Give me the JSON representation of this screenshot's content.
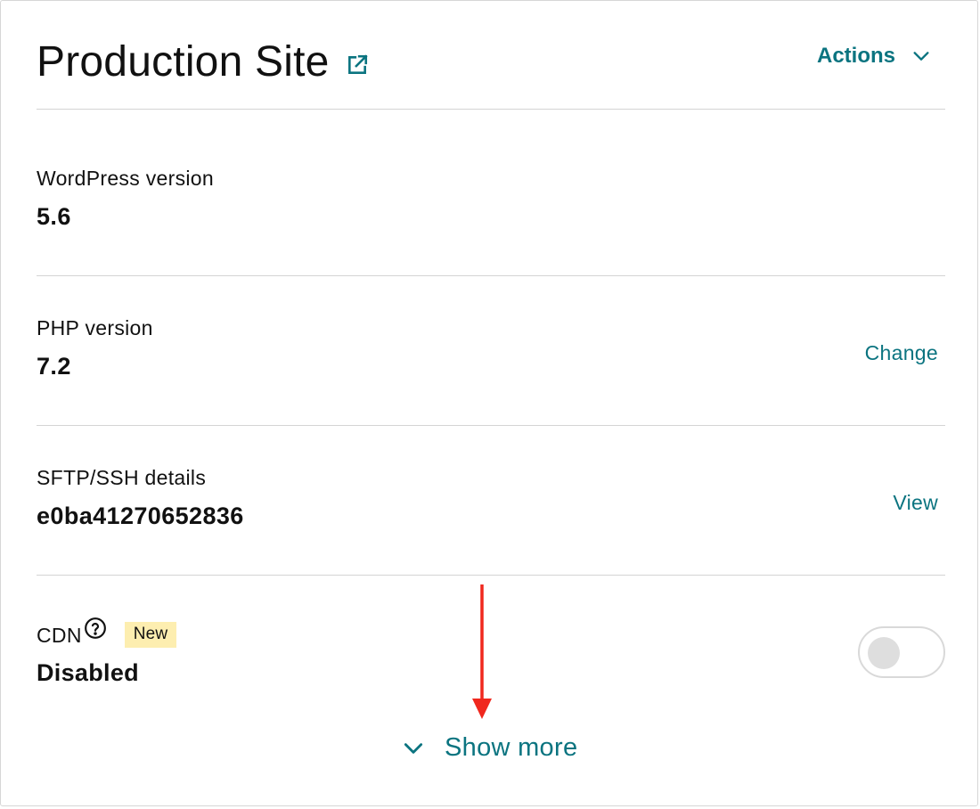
{
  "header": {
    "title": "Production Site",
    "external_link_icon": "external-link-icon",
    "actions_label": "Actions",
    "actions_icon": "chevron-down-icon"
  },
  "rows": [
    {
      "label": "WordPress version",
      "value": "5.6",
      "action": ""
    },
    {
      "label": "PHP version",
      "value": "7.2",
      "action": "Change"
    },
    {
      "label": "SFTP/SSH details",
      "value": "e0ba41270652836",
      "action": "View"
    }
  ],
  "cdn": {
    "label": "CDN",
    "help_icon": "question-circle-icon",
    "badge": "New",
    "value": "Disabled",
    "toggle_state": "off"
  },
  "footer": {
    "show_more_label": "Show more",
    "show_more_icon": "chevron-down-icon"
  },
  "colors": {
    "accent": "#0b7480",
    "badge_bg": "#fdeeb0",
    "annotation_arrow": "#f0281e",
    "divider": "#d4d4d4"
  }
}
